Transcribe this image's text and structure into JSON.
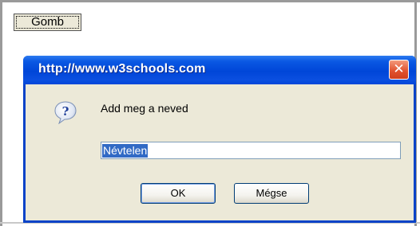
{
  "page": {
    "button_label": "Gomb"
  },
  "dialog": {
    "title": "http://www.w3schools.com",
    "close_glyph": "✕",
    "icon": "question-icon",
    "message": "Add meg a neved",
    "input": {
      "value": "Névtelen",
      "selected": true
    },
    "ok_label": "OK",
    "cancel_label": "Mégse"
  },
  "colors": {
    "title_bar": "#0046d8",
    "dialog_body": "#ece9d8",
    "close_button": "#e0502c",
    "selection": "#316ac5"
  }
}
